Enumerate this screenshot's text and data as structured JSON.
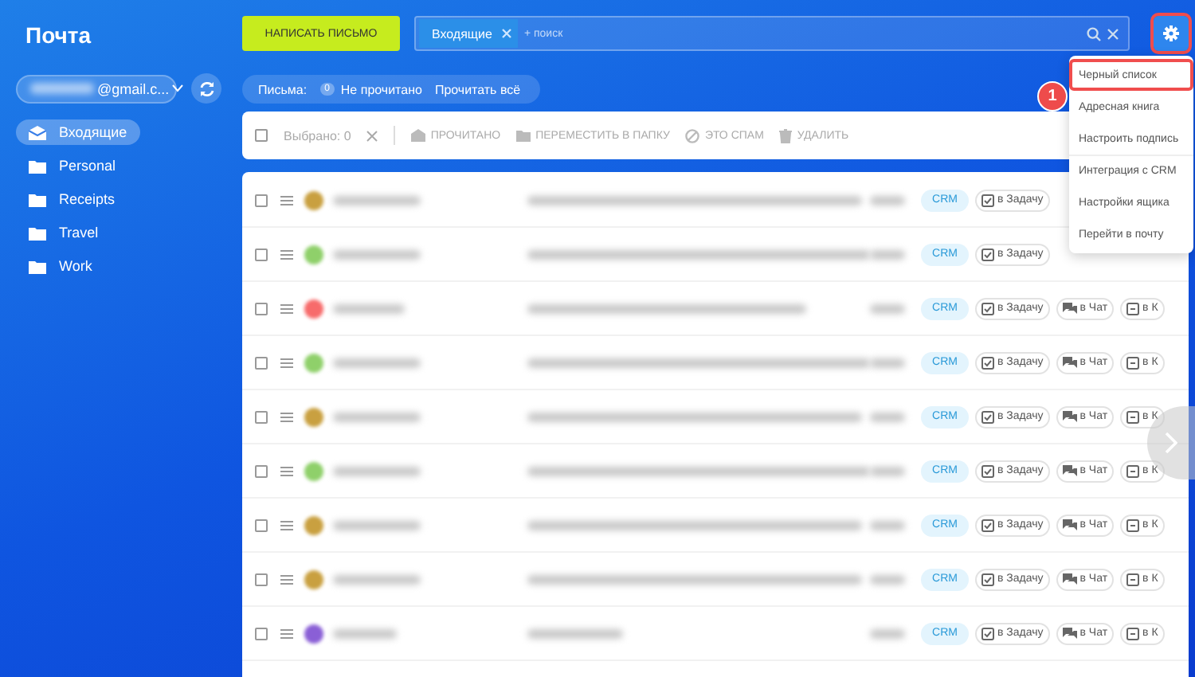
{
  "sidebar": {
    "title": "Почта",
    "account": "@gmail.c...",
    "folders": [
      {
        "label": "Входящие",
        "selected": true
      },
      {
        "label": "Personal",
        "selected": false
      },
      {
        "label": "Receipts",
        "selected": false
      },
      {
        "label": "Travel",
        "selected": false
      },
      {
        "label": "Work",
        "selected": false
      }
    ]
  },
  "compose_button": "НАПИСАТЬ ПИСЬМО",
  "search": {
    "chip": "Входящие",
    "placeholder": "+ поиск"
  },
  "letters_bar": {
    "label": "Письма:",
    "count": "0",
    "filter": "Не прочитано",
    "action": "Прочитать всё"
  },
  "toolbar": {
    "select_all_checked": false,
    "selected_label": "Выбрано: 0",
    "disabled": true,
    "actions": [
      {
        "kind": "read",
        "label": "ПРОЧИТАНО"
      },
      {
        "kind": "move",
        "label": "ПЕРЕМЕСТИТЬ В ПАПКУ"
      },
      {
        "kind": "spam",
        "label": "ЭТО СПАМ"
      },
      {
        "kind": "delete",
        "label": "УДАЛИТЬ"
      }
    ]
  },
  "messages": [
    {
      "checked": false,
      "color": "#c9a040",
      "tag": "CRM",
      "actions": [
        {
          "kind": "task",
          "label": "в Задачу"
        }
      ]
    },
    {
      "checked": false,
      "color": "#8fd06a",
      "tag": "CRM",
      "actions": [
        {
          "kind": "task",
          "label": "в Задачу"
        }
      ]
    },
    {
      "checked": false,
      "color": "#f76b6b",
      "tag": "CRM",
      "actions": [
        {
          "kind": "task",
          "label": "в Задачу"
        },
        {
          "kind": "chat",
          "label": "в Чат"
        },
        {
          "kind": "other",
          "label": "в К"
        }
      ]
    },
    {
      "checked": false,
      "color": "#8fd06a",
      "tag": "CRM",
      "actions": [
        {
          "kind": "task",
          "label": "в Задачу"
        },
        {
          "kind": "chat",
          "label": "в Чат"
        },
        {
          "kind": "other",
          "label": "в К"
        }
      ]
    },
    {
      "checked": false,
      "color": "#c9a040",
      "tag": "CRM",
      "actions": [
        {
          "kind": "task",
          "label": "в Задачу"
        },
        {
          "kind": "chat",
          "label": "в Чат"
        },
        {
          "kind": "other",
          "label": "в К"
        }
      ]
    },
    {
      "checked": false,
      "color": "#8fd06a",
      "tag": "CRM",
      "actions": [
        {
          "kind": "task",
          "label": "в Задачу"
        },
        {
          "kind": "chat",
          "label": "в Чат"
        },
        {
          "kind": "other",
          "label": "в К"
        }
      ]
    },
    {
      "checked": false,
      "color": "#c9a040",
      "tag": "CRM",
      "actions": [
        {
          "kind": "task",
          "label": "в Задачу"
        },
        {
          "kind": "chat",
          "label": "в Чат"
        },
        {
          "kind": "other",
          "label": "в К"
        }
      ]
    },
    {
      "checked": false,
      "color": "#c9a040",
      "tag": "CRM",
      "actions": [
        {
          "kind": "task",
          "label": "в Задачу"
        },
        {
          "kind": "chat",
          "label": "в Чат"
        },
        {
          "kind": "other",
          "label": "в К"
        }
      ]
    },
    {
      "checked": false,
      "color": "#8a5fd6",
      "tag": "CRM",
      "actions": [
        {
          "kind": "task",
          "label": "в Задачу"
        },
        {
          "kind": "chat",
          "label": "в Чат"
        },
        {
          "kind": "other",
          "label": "в К"
        }
      ]
    }
  ],
  "settings_menu": {
    "items": [
      {
        "label": "Черный список",
        "highlighted": true,
        "divider_before": false
      },
      {
        "label": "Адресная книга",
        "highlighted": false,
        "divider_before": false
      },
      {
        "label": "Настроить подпись",
        "highlighted": false,
        "divider_before": false
      },
      {
        "label": "Интеграция с CRM",
        "highlighted": false,
        "divider_before": true
      },
      {
        "label": "Настройки ящика",
        "highlighted": false,
        "divider_before": false
      },
      {
        "label": "Перейти в почту",
        "highlighted": false,
        "divider_before": false
      }
    ]
  },
  "annotation": {
    "label": "1"
  }
}
